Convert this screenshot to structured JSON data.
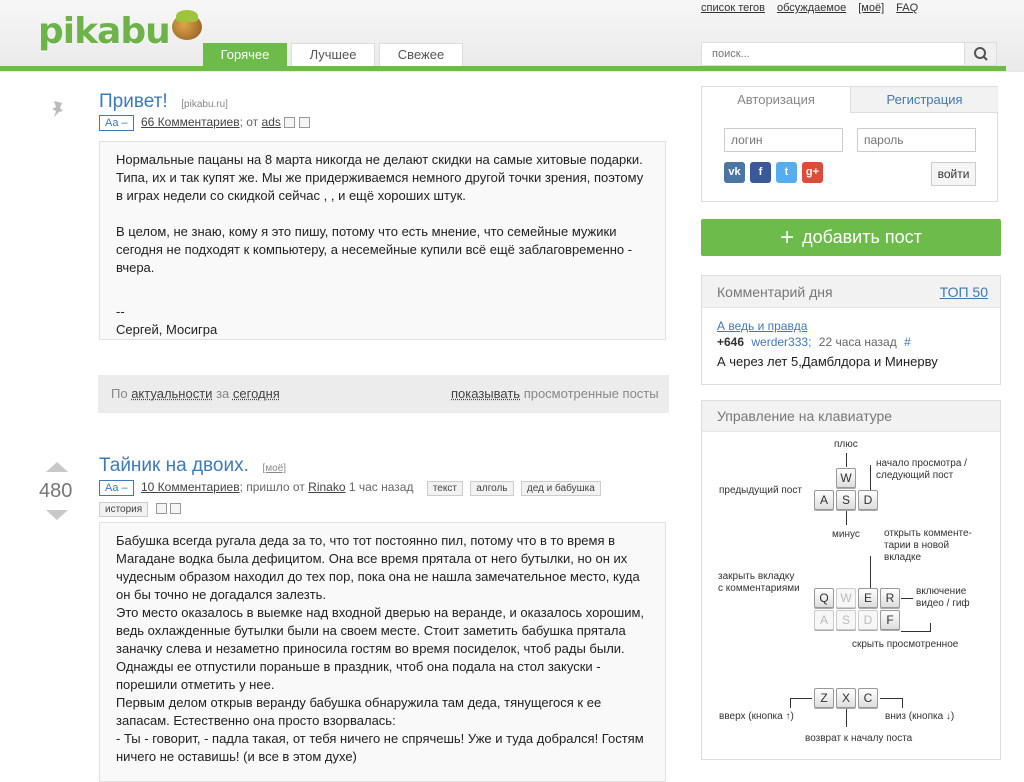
{
  "header": {
    "logo_text": "pikabu",
    "links": [
      "список тегов",
      "обсуждаемое",
      "[моё]",
      "FAQ"
    ],
    "tabs": [
      "Горячее",
      "Лучшее",
      "Свежее"
    ],
    "search_placeholder": "поиск..."
  },
  "post1": {
    "title": "Привет!",
    "source": "[pikabu.ru]",
    "font_toggle": "Aa –",
    "comments": "66 Комментариев",
    "meta_from": "; от",
    "author": "ads",
    "paragraphs": [
      "Нормальные пацаны на 8 марта никогда не делают скидки на самые хитовые подарки. Типа, их и так купят же. Мы же придерживаемся немного другой точки зрения, поэтому в играх недели со скидкой сейчас , , и ещё хороших штук.",
      "",
      "В целом, не знаю, кому я это пишу, потому что есть мнение, что семейные мужики сегодня не подходят к компьютеру, а несемейные купили всё ещё заблаговременно - вчера.",
      "",
      "--",
      "Сергей, Мосигра"
    ]
  },
  "filter": {
    "by": "По",
    "sort": "актуальности",
    "for": "за",
    "period": "сегодня",
    "show": "показывать",
    "viewed": "просмотренные посты"
  },
  "post2": {
    "rating": "480",
    "title": "Тайник на двоих.",
    "source": "[моё]",
    "font_toggle": "Aa –",
    "comments": "10 Комментариев",
    "meta_from": "; пришло от",
    "author": "Rinako",
    "time": "1 час назад",
    "tags": [
      "текст",
      "алголь",
      "дед и бабушка",
      "история"
    ],
    "paragraphs": [
      "Бабушка всегда ругала деда за то, что тот постоянно пил, потому что в то время в Магадане водка была дефицитом. Она все время прятала от него бутылки, но он их чудесным образом находил до тех пор, пока она не нашла замечательное место, куда он бы точно не догадался залезть.",
      "Это место оказалось в выемке над входной дверью на веранде, и оказалось хорошим, ведь охлажденные бутылки были на своем месте. Стоит заметить бабушка прятала заначку слева и незаметно приносила гостям во время посиделок, чтоб рады были.",
      "Однажды ее отпустили пораньше в праздник, чтоб она подала на стол закуски - порешили отметить у нее.",
      "Первым делом открыв веранду бабушка обнаружила там деда, тянущегося к ее запасам. Естественно она просто взорвалась:",
      "- Ты - говорит, - падла такая, от тебя ничего не спрячешь! Уже и туда добрался! Гостям ничего не оставишь! (и все в этом духе)"
    ]
  },
  "auth": {
    "tab_login": "Авторизация",
    "tab_register": "Регистрация",
    "login_placeholder": "логин",
    "password_placeholder": "пароль",
    "enter": "войти",
    "social": [
      {
        "name": "vk-icon",
        "label": "vk",
        "color": "#4c75a3"
      },
      {
        "name": "facebook-icon",
        "label": "f",
        "color": "#3b5998"
      },
      {
        "name": "twitter-icon",
        "label": "t",
        "color": "#55acee"
      },
      {
        "name": "google-plus-icon",
        "label": "g+",
        "color": "#dd4b39"
      }
    ]
  },
  "add_post": "добавить пост",
  "comment_of_day": {
    "heading": "Комментарий дня",
    "top": "ТОП 50",
    "link": "А ведь и правда",
    "score": "+646",
    "user": "werder333;",
    "time": "22 часа назад",
    "hash": "#",
    "text": "А через лет 5,Дамблдора и Минерву"
  },
  "keyboard": {
    "heading": "Управление на клавиатуре",
    "labels": {
      "plus": "плюс",
      "start": "начало просмотра /",
      "next": "следующий пост",
      "prev": "предыдущий пост",
      "minus": "минус",
      "open_comments": "открыть комменте-",
      "open_comments2": "тарии в новой",
      "open_comments3": "вкладке",
      "close_tab": "закрыть вкладку",
      "close_tab2": "с комментариями",
      "video": "включение",
      "video2": "видео / гиф",
      "hide": "скрыть просмотренное",
      "up": "вверх (кнопка ↑)",
      "down": "вниз (кнопка ↓)",
      "back": "возврат к началу поста"
    }
  }
}
